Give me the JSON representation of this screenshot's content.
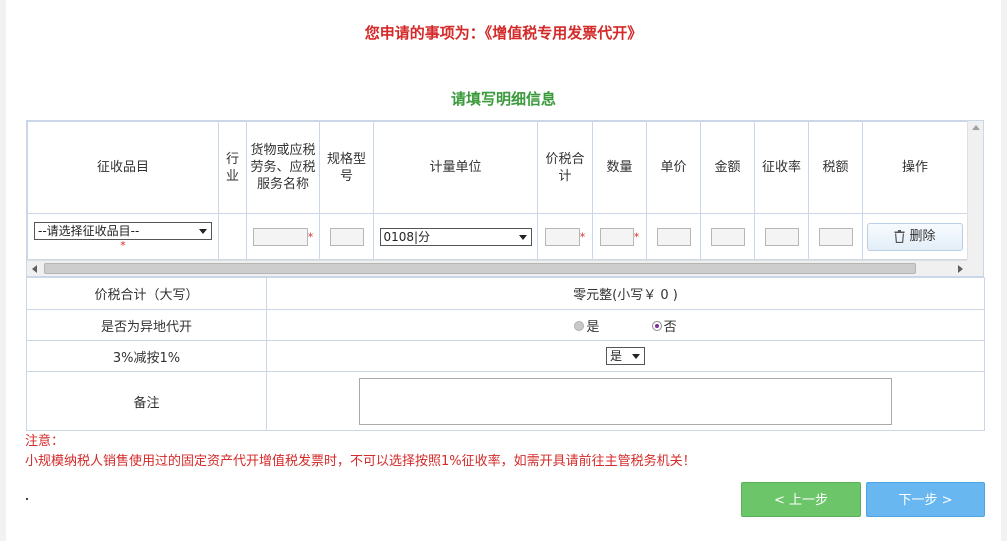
{
  "header": {
    "title": "您申请的事项为：《增值税专用发票代开》",
    "subtitle": "请填写明细信息"
  },
  "detail": {
    "columns": [
      "征收品目",
      "行业",
      "货物或应税劳务、应税服务名称",
      "规格型号",
      "计量单位",
      "价税合计",
      "数量",
      "单价",
      "金额",
      "征收率",
      "税额",
      "操作"
    ],
    "row": {
      "item_select": "--请选择征收品目--",
      "unit_select": "0108|分",
      "delete_label": "删除",
      "required_mark": "*"
    }
  },
  "summary": {
    "total_label": "价税合计（大写）",
    "total_value": "零元整(小写￥ 0 )",
    "remote_label": "是否为异地代开",
    "remote_yes": "是",
    "remote_no": "否",
    "remote_selected": "否",
    "reduction_label": "3%减按1%",
    "reduction_value": "是",
    "remark_label": "备注"
  },
  "notice": {
    "title": "注意：",
    "text": "小规模纳税人销售使用过的固定资产代开增值税发票时，不可以选择按照1%征收率，如需开具请前往主管税务机关！"
  },
  "buttons": {
    "prev": "< 上一步",
    "next": "下一步 >"
  },
  "colors": {
    "title_red": "#d42a2a",
    "subtitle_green": "#3b9a3b",
    "prev_green": "#6dc56a",
    "next_blue": "#69b7f0",
    "border": "#c9d7e6"
  }
}
